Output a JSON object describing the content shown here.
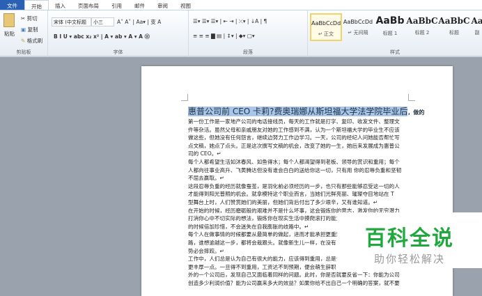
{
  "tabs": [
    "文件",
    "开始",
    "插入",
    "页面布局",
    "引用",
    "邮件",
    "审阅",
    "视图"
  ],
  "clipboard": {
    "paste": "粘贴",
    "cut": "剪切",
    "copy": "复制",
    "format_painter": "格式刷",
    "label": "剪贴板"
  },
  "font": {
    "name": "宋体 (中文标题",
    "size": "小三",
    "label": "字体",
    "row1": "A˄ A˅ | Aa▾ | 变 A",
    "row2": "B  I  U ▾ abc  x₂  x²  | A ▾  ab ▾  A ▾  A  ㊂"
  },
  "paragraph": {
    "label": "段落",
    "row1": "☰▾ ☰▾ ☰▾ | ⇤ ⇥ | ⤫▾ | ↓A | ¶",
    "row2": "≡ ≡ ≡ ▇ ▤ | ↕▾ | ◆▾ ▢▾"
  },
  "styles": {
    "label": "样式",
    "items": [
      {
        "preview": "AaBbCcDd",
        "name": "↵ 正文"
      },
      {
        "preview": "AaBbCcDd",
        "name": "↵ 无间隔"
      },
      {
        "preview": "AaBb",
        "name": "标题 1"
      },
      {
        "preview": "AaBbC",
        "name": "标题 2"
      },
      {
        "preview": "AaBbC",
        "name": "标题"
      },
      {
        "preview": "Aa",
        "name": "副"
      }
    ]
  },
  "document": {
    "title_highlight": "惠普公司前 CEO 卡莉?费奥瑞娜从斯坦福大学法学院毕业后",
    "title_rest": "，做的",
    "lines": [
      "第一份工作是一家地产公司的电话接线员，每天的工作就是打字、复印、收发文件、整理文",
      "件等杂活。虽然父母和亲戚朋友对她的工作感到不满，认为一个斯坦福大学的毕业生不应该",
      "做这些，但她没有任何怨言，继续边努力工作边学习。一天，公司的经纪人问她能否帮忙写",
      "点文稿，她点了点头。正是这次撰写文稿的机会，改变了她的一生，她后来发展成为惠普公",
      "司的 CEO。↵",
      "每个人都希望生活如沐春风、如鱼得水；每个人都渴望得到老板、领导的赏识和重用；每个",
      "人都向往事业高升、飞黄腾达但没有谁会白白的送给你这一切，只有用 你的忍辱负重和坚韧",
      "不屈去赢取。↵",
      "这段忍辱负重的经历就像蚕茧，是羽化前必须经历的一步，也只有那些能够忍受这一切的人",
      "才能得到阳光普照的机会。就拿模特这个职业而言，当她们光鲜亮丽、璀璨夺目地站在 T",
      "型舞台上时，人们赞赏她们的美丽，但她们背后付出了多少艰辛，又有谁知道。↵",
      "在开始的时候，经历磨砺般的艰难并不是什么坏事，这会锻炼你的意志，激发你的无穷潜力",
      "打消你心中不切实际的想法，锻炼你在现实生活中摸爬滚打的能力",
      "的时候倍加珍惜，不会迷失在自我膨胀的歧路中。↵",
      "每个人在做事情的时候都要从最简单的做起，进而才能承担更重要",
      "路，谁想逾越这一步，都将会栽跟头。就像新生儿一样，在没有",
      "势必会摔跤。↵",
      "工作中，人们总是认为自己有很大的能力，应该得到重用，总是认",
      "更丰厚一点。一旦得不到重用，工资达不到预期，便会萌生辞职",
      "外的一个公司后，发现自己又面临着同样的问题。此时，你是否就要反省一下：你能为公司",
      "创造多少利润价值？能为公司赢来多大的效益？如果你给不出自己一个明确的答案，就不要"
    ]
  },
  "watermark": {
    "title": "百科全说",
    "subtitle": "助你轻松解决"
  },
  "colors": {
    "file_tab": "#2a61b5",
    "highlight": "#a8c5ea",
    "watermark": "#20a83e"
  }
}
